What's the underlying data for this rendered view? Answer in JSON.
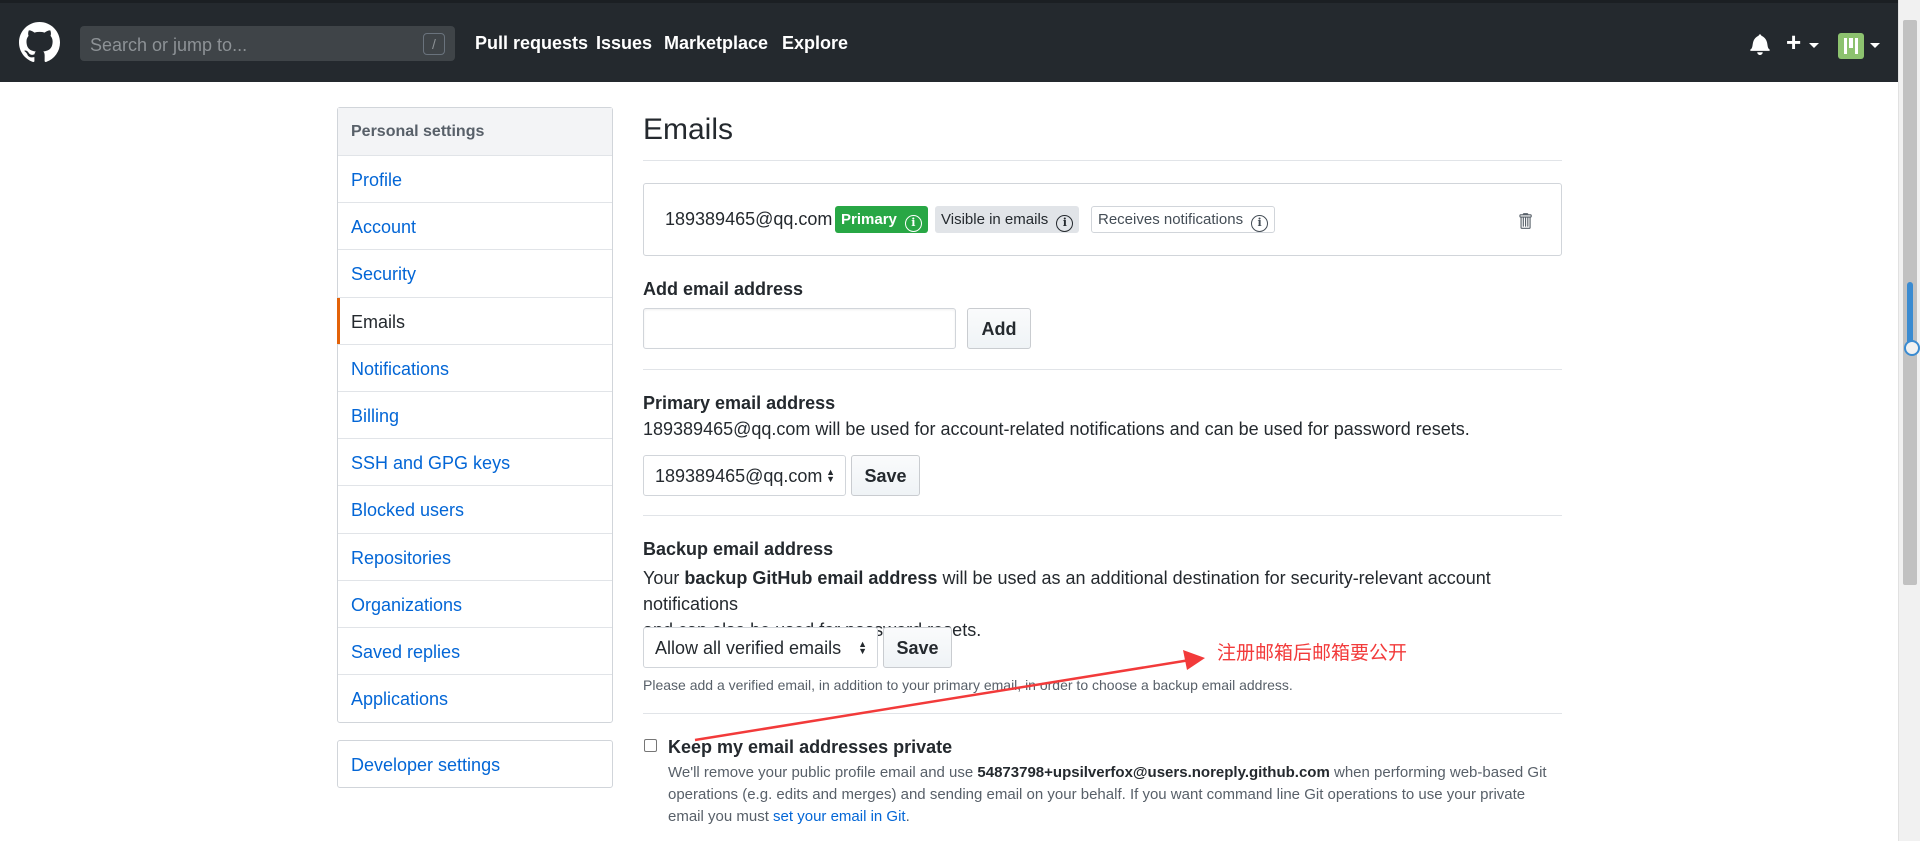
{
  "header": {
    "search_placeholder": "Search or jump to...",
    "search_shortcut": "/",
    "nav": [
      "Pull requests",
      "Issues",
      "Marketplace",
      "Explore"
    ],
    "plus_glyph": "+"
  },
  "sidebar": {
    "heading": "Personal settings",
    "items": [
      {
        "label": "Profile"
      },
      {
        "label": "Account"
      },
      {
        "label": "Security"
      },
      {
        "label": "Emails"
      },
      {
        "label": "Notifications"
      },
      {
        "label": "Billing"
      },
      {
        "label": "SSH and GPG keys"
      },
      {
        "label": "Blocked users"
      },
      {
        "label": "Repositories"
      },
      {
        "label": "Organizations"
      },
      {
        "label": "Saved replies"
      },
      {
        "label": "Applications"
      }
    ],
    "developer_settings": "Developer settings"
  },
  "main": {
    "title": "Emails",
    "email_entry": {
      "address": "189389465@qq.com",
      "badge_primary": "Primary",
      "badge_visible": "Visible in emails",
      "badge_notifications": "Receives notifications"
    },
    "add_email": {
      "label": "Add email address",
      "value": "",
      "button": "Add"
    },
    "primary_email": {
      "label": "Primary email address",
      "description": "189389465@qq.com will be used for account-related notifications and can be used for password resets.",
      "selected": "189389465@qq.com",
      "button": "Save"
    },
    "backup_email": {
      "label": "Backup email address",
      "desc_prefix": "Your ",
      "desc_bold": "backup GitHub email address",
      "desc_suffix": " will be used as an additional destination for security-relevant account notifications",
      "desc_line2": "and can also be used for password resets.",
      "selected": "Allow all verified emails",
      "button": "Save",
      "note": "Please add a verified email, in addition to your primary email, in order to choose a backup email address."
    },
    "keep_private": {
      "label": "Keep my email addresses private",
      "checked": false,
      "text_prefix": "We'll remove your public profile email and use ",
      "noreply_email": "54873798+upsilverfox@users.noreply.github.com",
      "text_middle": " when performing web-based Git",
      "text_line2": "operations (e.g. edits and merges) and sending email on your behalf. If you want command line Git operations to use your private",
      "text_line3_prefix": "email you must ",
      "link": "set your email in Git",
      "text_line3_suffix": "."
    }
  },
  "annotation": {
    "text": "注册邮箱后邮箱要公开",
    "color": "#f23a3a"
  },
  "colors": {
    "header_bg": "#24292e",
    "link": "#0366d6",
    "primary_badge": "#28a745",
    "selected_marker": "#e36209"
  }
}
